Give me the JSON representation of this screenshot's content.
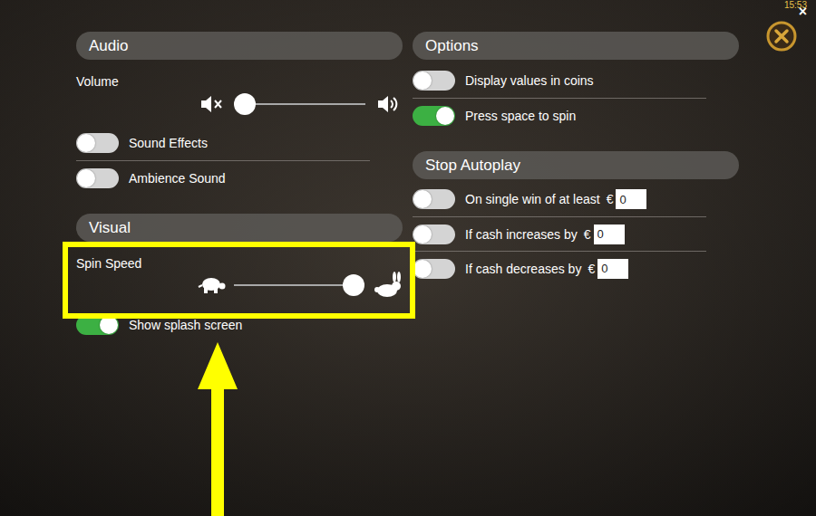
{
  "clock": "15:53",
  "close_glyph": "×",
  "audio": {
    "title": "Audio",
    "volume": {
      "label": "Volume",
      "level": 0.08
    },
    "toggles": [
      {
        "label": "Sound Effects",
        "on": false
      },
      {
        "label": "Ambience Sound",
        "on": false
      }
    ]
  },
  "visual": {
    "title": "Visual",
    "spin_speed": {
      "label": "Spin Speed",
      "level": 1
    },
    "toggles": [
      {
        "label": "Show splash screen",
        "on": true
      }
    ]
  },
  "options": {
    "title": "Options",
    "toggles": [
      {
        "label": "Display values in coins",
        "on": false
      },
      {
        "label": "Press space to spin",
        "on": true
      }
    ]
  },
  "stop_autoplay": {
    "title": "Stop Autoplay",
    "rules": [
      {
        "label": "On single win of at least",
        "currency": "€",
        "value": "0",
        "on": false
      },
      {
        "label": "If cash increases by",
        "currency": "€",
        "value": "0",
        "on": false
      },
      {
        "label": "If cash decreases by",
        "currency": "€",
        "value": "0",
        "on": false
      }
    ]
  }
}
